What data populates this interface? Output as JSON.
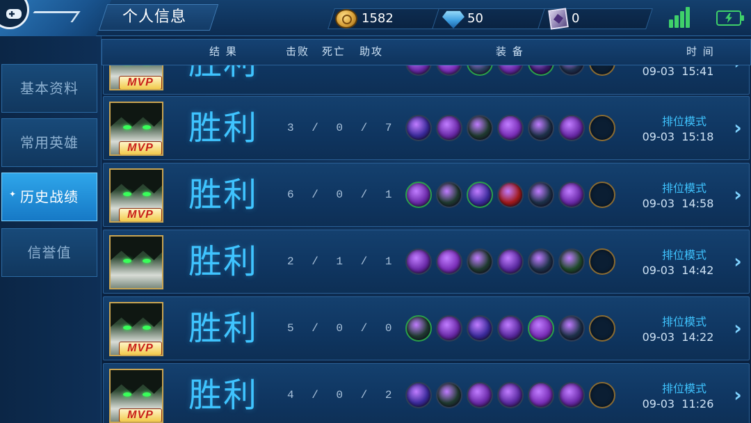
{
  "header": {
    "title": "个人信息",
    "coins": "1582",
    "gems": "50",
    "cards": "0"
  },
  "sidebar": {
    "items": [
      {
        "label": "基本资料"
      },
      {
        "label": "常用英雄"
      },
      {
        "label": "历史战绩"
      },
      {
        "label": "信誉值"
      }
    ],
    "active_index": 2
  },
  "table": {
    "headers": {
      "result": "结 果",
      "kills": "击败",
      "deaths": "死亡",
      "assists": "助攻",
      "equipment": "装 备",
      "time": "时 间"
    },
    "rows": [
      {
        "result": "胜利",
        "kda": "",
        "mode": "",
        "time": "09-03  15:41",
        "mvp": "MVP",
        "partial": true
      },
      {
        "result": "胜利",
        "kda": "3 / 0 / 7",
        "mode": "排位模式",
        "time": "09-03  15:18",
        "mvp": "MVP"
      },
      {
        "result": "胜利",
        "kda": "6 / 0 / 1",
        "mode": "排位模式",
        "time": "09-03  14:58",
        "mvp": "MVP"
      },
      {
        "result": "胜利",
        "kda": "2 / 1 / 1",
        "mode": "排位模式",
        "time": "09-03  14:42",
        "mvp": ""
      },
      {
        "result": "胜利",
        "kda": "5 / 0 / 0",
        "mode": "排位模式",
        "time": "09-03  14:22",
        "mvp": "MVP"
      },
      {
        "result": "胜利",
        "kda": "4 / 0 / 2",
        "mode": "排位模式",
        "time": "09-03  11:26",
        "mvp": "MVP"
      }
    ]
  },
  "icons": {
    "back": "gamepad-icon",
    "coin": "gold-coin-icon",
    "gem": "diamond-icon",
    "card": "voucher-card-icon",
    "signal": "signal-icon",
    "battery": "battery-charging-icon",
    "row_chevron": "chevron-right-icon"
  },
  "colors": {
    "accent": "#3fc4ff",
    "active_tab": "#1f8fd8",
    "status_green": "#3fd06a",
    "mvp_red": "#c8201a"
  }
}
